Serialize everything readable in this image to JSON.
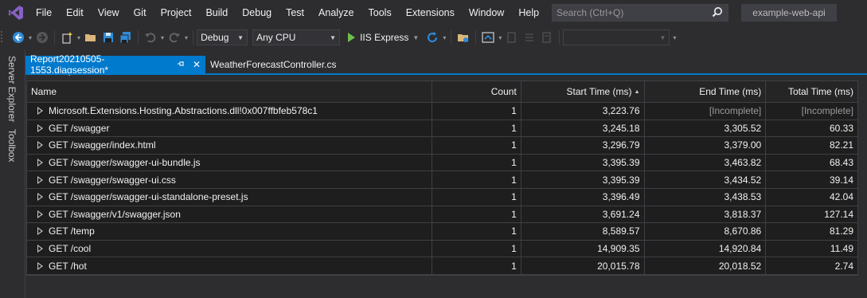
{
  "menu": {
    "items": [
      "File",
      "Edit",
      "View",
      "Git",
      "Project",
      "Build",
      "Debug",
      "Test",
      "Analyze",
      "Tools",
      "Extensions",
      "Window",
      "Help"
    ],
    "search_placeholder": "Search (Ctrl+Q)",
    "solution_name": "example-web-api"
  },
  "toolbar": {
    "configuration": "Debug",
    "platform": "Any CPU",
    "run_label": "IIS Express",
    "empty_combo": ""
  },
  "side_tabs": {
    "server_explorer": "Server Explorer",
    "toolbox": "Toolbox"
  },
  "doc_tabs": {
    "active": "Report20210505-1553.diagsession*",
    "inactive": "WeatherForecastController.cs"
  },
  "grid": {
    "columns": {
      "name": "Name",
      "count": "Count",
      "start": "Start Time (ms)",
      "end": "End Time (ms)",
      "total": "Total Time (ms)"
    },
    "rows": [
      {
        "name": "Microsoft.Extensions.Hosting.Abstractions.dll!0x007ffbfeb578c1",
        "count": "1",
        "start": "3,223.76",
        "end": "[Incomplete]",
        "total": "[Incomplete]"
      },
      {
        "name": "GET /swagger",
        "count": "1",
        "start": "3,245.18",
        "end": "3,305.52",
        "total": "60.33"
      },
      {
        "name": "GET /swagger/index.html",
        "count": "1",
        "start": "3,296.79",
        "end": "3,379.00",
        "total": "82.21"
      },
      {
        "name": "GET /swagger/swagger-ui-bundle.js",
        "count": "1",
        "start": "3,395.39",
        "end": "3,463.82",
        "total": "68.43"
      },
      {
        "name": "GET /swagger/swagger-ui.css",
        "count": "1",
        "start": "3,395.39",
        "end": "3,434.52",
        "total": "39.14"
      },
      {
        "name": "GET /swagger/swagger-ui-standalone-preset.js",
        "count": "1",
        "start": "3,396.49",
        "end": "3,438.53",
        "total": "42.04"
      },
      {
        "name": "GET /swagger/v1/swagger.json",
        "count": "1",
        "start": "3,691.24",
        "end": "3,818.37",
        "total": "127.14"
      },
      {
        "name": "GET /temp",
        "count": "1",
        "start": "8,589.57",
        "end": "8,670.86",
        "total": "81.29"
      },
      {
        "name": "GET /cool",
        "count": "1",
        "start": "14,909.35",
        "end": "14,920.84",
        "total": "11.49"
      },
      {
        "name": "GET /hot",
        "count": "1",
        "start": "20,015.78",
        "end": "20,018.52",
        "total": "2.74"
      }
    ]
  },
  "colors": {
    "accent": "#007acc",
    "run": "#6fbf4b",
    "logo": "#8661c5"
  }
}
